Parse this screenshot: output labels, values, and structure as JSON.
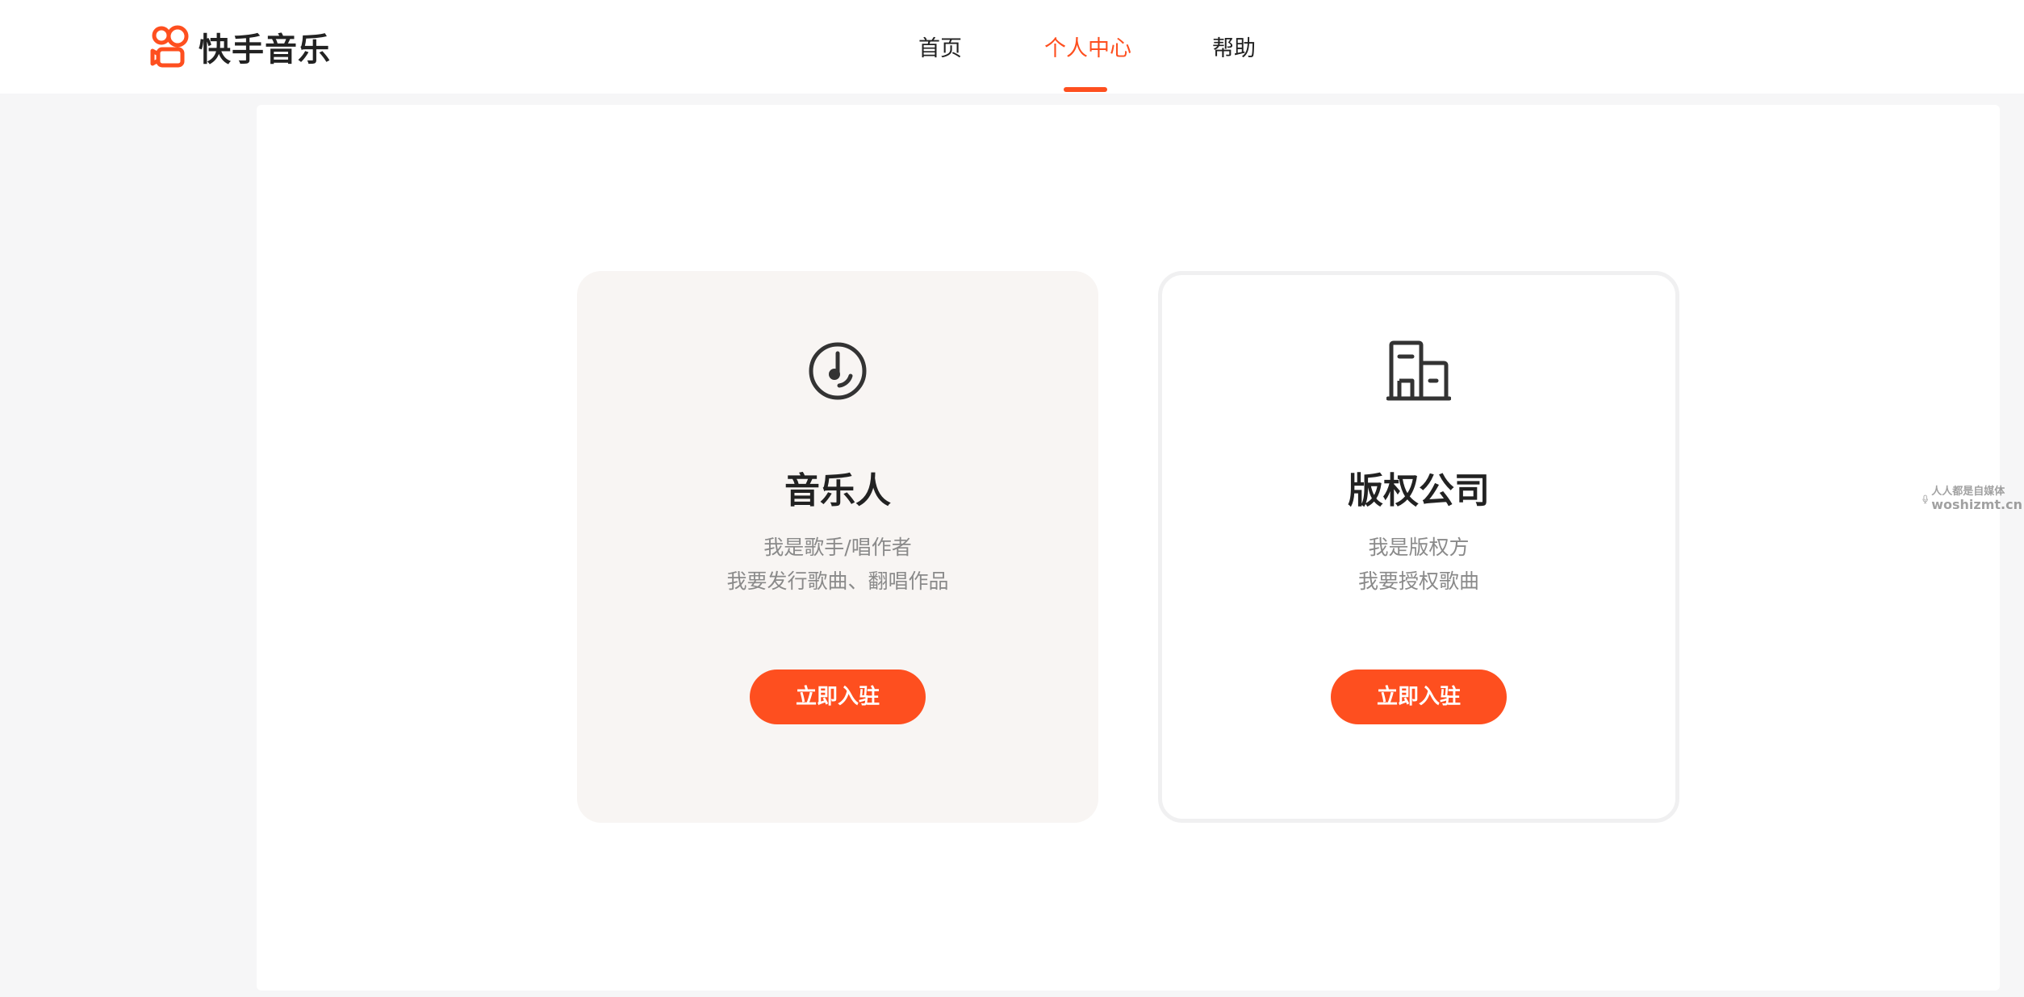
{
  "header": {
    "logo_text": "快手音乐",
    "logo_icon": "kuaishou-logo-icon",
    "brand_color": "#fe4f1f",
    "nav": [
      {
        "label": "首页",
        "active": false
      },
      {
        "label": "个人中心",
        "active": true
      },
      {
        "label": "帮助",
        "active": false
      }
    ]
  },
  "cards": [
    {
      "icon": "music-disc-icon",
      "title": "音乐人",
      "desc_line1": "我是歌手/唱作者",
      "desc_line2": "我要发行歌曲、翻唱作品",
      "button_label": "立即入驻"
    },
    {
      "icon": "building-icon",
      "title": "版权公司",
      "desc_line1": "我是版权方",
      "desc_line2": "我要授权歌曲",
      "button_label": "立即入驻"
    }
  ],
  "watermark": {
    "line1": "人人都是自媒体",
    "line2": "woshizmt.cn"
  }
}
